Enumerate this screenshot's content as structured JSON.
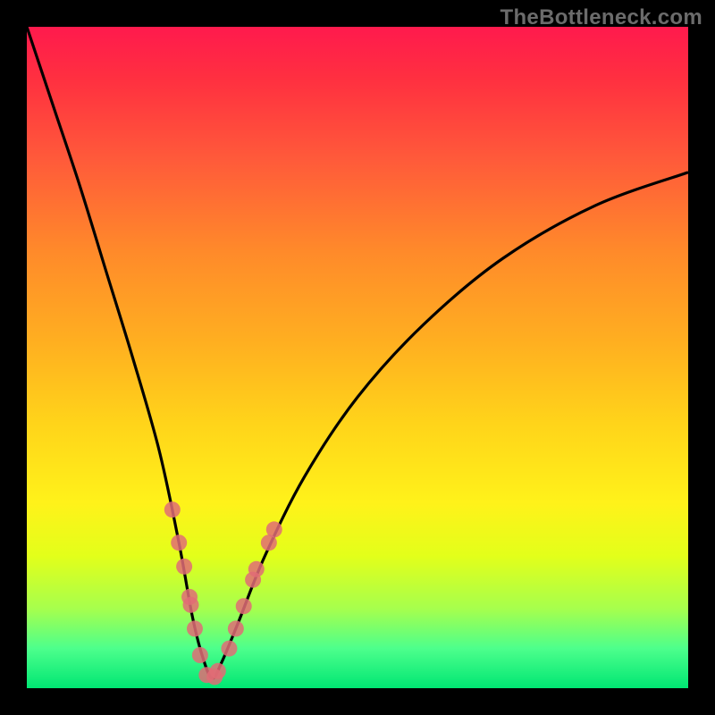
{
  "watermark": "TheBottleneck.com",
  "chart_data": {
    "type": "line",
    "title": "",
    "xlabel": "",
    "ylabel": "",
    "xlim": [
      0,
      100
    ],
    "ylim": [
      0,
      100
    ],
    "grid": false,
    "legend": false,
    "curve": {
      "name": "bottleneck-curve",
      "x": [
        0,
        4,
        8,
        12,
        16,
        20,
        23,
        25,
        26.5,
        28,
        29.5,
        32,
        36,
        42,
        50,
        60,
        72,
        86,
        100
      ],
      "y": [
        100,
        88,
        76,
        63,
        50,
        36,
        22,
        11,
        5,
        1.5,
        4,
        10,
        20,
        32,
        44,
        55,
        65,
        73,
        78
      ]
    },
    "sample_points": {
      "name": "sample-dots",
      "x": [
        22.0,
        23.0,
        23.8,
        24.6,
        24.8,
        25.4,
        26.2,
        27.2,
        28.4,
        28.9,
        30.6,
        31.6,
        32.8,
        34.2,
        34.7,
        36.6,
        37.4
      ],
      "y": [
        27.0,
        22.0,
        18.4,
        13.8,
        12.6,
        9.0,
        5.0,
        2.0,
        1.7,
        2.6,
        6.0,
        9.0,
        12.4,
        16.4,
        18.0,
        22.0,
        24.0
      ]
    },
    "gradient_stops": [
      {
        "pos": 0,
        "color": "#ff1a4d"
      },
      {
        "pos": 50,
        "color": "#ffd41a"
      },
      {
        "pos": 100,
        "color": "#00e673"
      }
    ]
  }
}
